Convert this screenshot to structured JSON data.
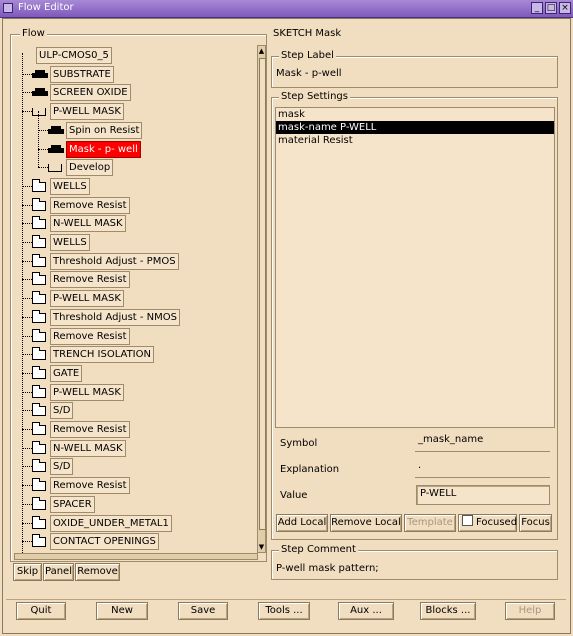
{
  "window": {
    "title": "Flow Editor",
    "min_glyph": "_",
    "max_glyph": "□",
    "close_glyph": "×"
  },
  "flow": {
    "group_title": "Flow",
    "tree": [
      {
        "label": "ULP-CMOS0_5",
        "kind": "root",
        "indent": 0
      },
      {
        "label": "SUBSTRATE",
        "kind": "step",
        "indent": 1
      },
      {
        "label": "SCREEN OXIDE",
        "kind": "step",
        "indent": 1
      },
      {
        "label": "P-WELL MASK",
        "kind": "open",
        "indent": 1
      },
      {
        "label": "Spin on Resist",
        "kind": "step",
        "indent": 2
      },
      {
        "label": "Mask - p- well",
        "kind": "step",
        "indent": 2,
        "selected": true
      },
      {
        "label": "Develop",
        "kind": "open",
        "indent": 2
      },
      {
        "label": "WELLS",
        "kind": "folder",
        "indent": 1
      },
      {
        "label": "Remove Resist",
        "kind": "folder",
        "indent": 1
      },
      {
        "label": "N-WELL MASK",
        "kind": "folder",
        "indent": 1
      },
      {
        "label": "WELLS",
        "kind": "folder",
        "indent": 1
      },
      {
        "label": "Threshold Adjust - PMOS",
        "kind": "folder",
        "indent": 1
      },
      {
        "label": "Remove Resist",
        "kind": "folder",
        "indent": 1
      },
      {
        "label": "P-WELL MASK",
        "kind": "folder",
        "indent": 1
      },
      {
        "label": "Threshold Adjust - NMOS",
        "kind": "folder",
        "indent": 1
      },
      {
        "label": "Remove Resist",
        "kind": "folder",
        "indent": 1
      },
      {
        "label": "TRENCH ISOLATION",
        "kind": "folder",
        "indent": 1
      },
      {
        "label": "GATE",
        "kind": "folder",
        "indent": 1
      },
      {
        "label": "P-WELL MASK",
        "kind": "folder",
        "indent": 1
      },
      {
        "label": "S/D",
        "kind": "folder",
        "indent": 1
      },
      {
        "label": "Remove Resist",
        "kind": "folder",
        "indent": 1
      },
      {
        "label": "N-WELL MASK",
        "kind": "folder",
        "indent": 1
      },
      {
        "label": "S/D",
        "kind": "folder",
        "indent": 1
      },
      {
        "label": "Remove Resist",
        "kind": "folder",
        "indent": 1
      },
      {
        "label": "SPACER",
        "kind": "folder",
        "indent": 1
      },
      {
        "label": "OXIDE_UNDER_METAL1",
        "kind": "folder",
        "indent": 1
      },
      {
        "label": "CONTACT OPENINGS",
        "kind": "folder",
        "indent": 1
      }
    ],
    "buttons": {
      "skip": "Skip",
      "panel": "Panel",
      "remove": "Remove"
    }
  },
  "step": {
    "header": "SKETCH Mask",
    "label_group": "Step Label",
    "label_value": "Mask - p-well",
    "settings_group": "Step Settings",
    "settings_items": [
      {
        "text": "mask",
        "selected": false
      },
      {
        "text": "mask-name P-WELL",
        "selected": true
      },
      {
        "text": "material Resist",
        "selected": false
      }
    ],
    "symbol_label": "Symbol",
    "symbol_value": "_mask_name",
    "explanation_label": "Explanation",
    "explanation_value": ".",
    "value_label": "Value",
    "value_value": "P-WELL",
    "buttons": {
      "add_local": "Add Local",
      "remove_local": "Remove Local",
      "template": "Template",
      "focused": "Focused",
      "focus": "Focus"
    },
    "comment_group": "Step Comment",
    "comment_value": "P-well mask pattern;"
  },
  "bottom": {
    "quit": "Quit",
    "new": "New",
    "save": "Save",
    "tools": "Tools ...",
    "aux": "Aux ...",
    "blocks": "Blocks ...",
    "help": "Help"
  }
}
